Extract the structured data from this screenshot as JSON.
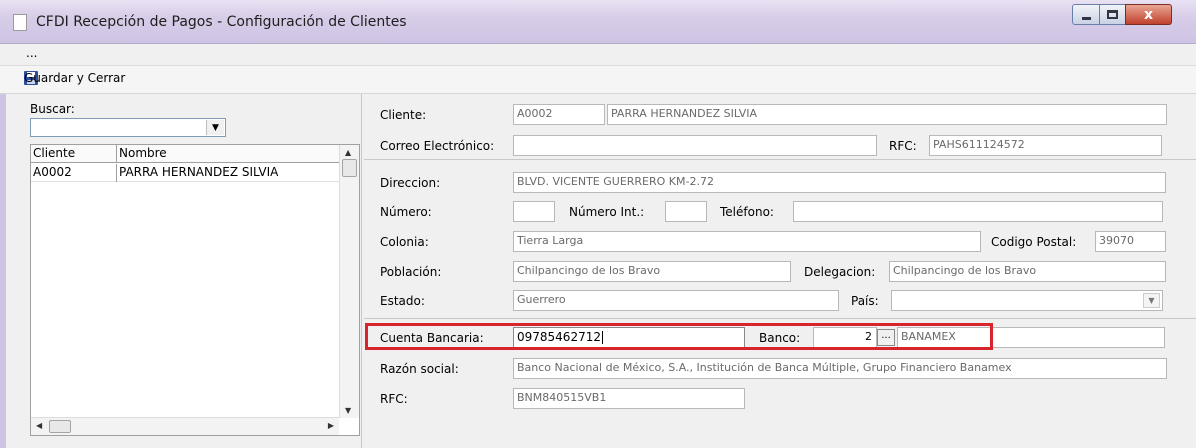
{
  "window": {
    "title": "CFDI Recepción de Pagos - Configuración de Clientes",
    "minimize_glyph": "",
    "maximize_glyph": "",
    "close_glyph": "x"
  },
  "menubar": {
    "overflow_label": "..."
  },
  "toolbar": {
    "save_close_label": "Guardar y Cerrar",
    "save_icon": "floppy-disk-icon"
  },
  "search": {
    "label": "Buscar:",
    "value": "",
    "dropdown_icon": "chevron-down-icon"
  },
  "client_grid": {
    "columns": [
      "Cliente",
      "Nombre"
    ],
    "rows": [
      {
        "cliente": "A0002",
        "nombre": "PARRA HERNANDEZ SILVIA"
      }
    ]
  },
  "form": {
    "cliente_label": "Cliente:",
    "cliente_code": "A0002",
    "cliente_name": "PARRA HERNANDEZ SILVIA",
    "correo_label": "Correo Electrónico:",
    "correo_value": "",
    "rfc_label": "RFC:",
    "rfc_value": "PAHS611124572",
    "direccion_label": "Direccion:",
    "direccion_value": "BLVD. VICENTE GUERRERO KM-2.72",
    "numero_label": "Número:",
    "numero_value": "",
    "numero_int_label": "Número Int.:",
    "numero_int_value": "",
    "telefono_label": "Teléfono:",
    "telefono_value": "",
    "colonia_label": "Colonia:",
    "colonia_value": "Tierra Larga",
    "cp_label": "Codigo Postal:",
    "cp_value": "39070",
    "poblacion_label": "Población:",
    "poblacion_value": "Chilpancingo de los Bravo",
    "delegacion_label": "Delegacion:",
    "delegacion_value": "Chilpancingo de los Bravo",
    "estado_label": "Estado:",
    "estado_value": "Guerrero",
    "pais_label": "País:",
    "pais_value": "",
    "cuenta_label": "Cuenta Bancaria:",
    "cuenta_value": "09785462712",
    "banco_label": "Banco:",
    "banco_code": "2",
    "banco_browse": "...",
    "banco_name": "BANAMEX",
    "razon_label": "Razón social:",
    "razon_value": "Banco Nacional de México, S.A., Institución de Banca Múltiple, Grupo Financiero Banamex",
    "rfc_banco_label": "RFC:",
    "rfc_banco_value": "BNM840515VB1"
  },
  "colors": {
    "highlight": "#d8252c",
    "titlebar": "#d7cde8"
  }
}
